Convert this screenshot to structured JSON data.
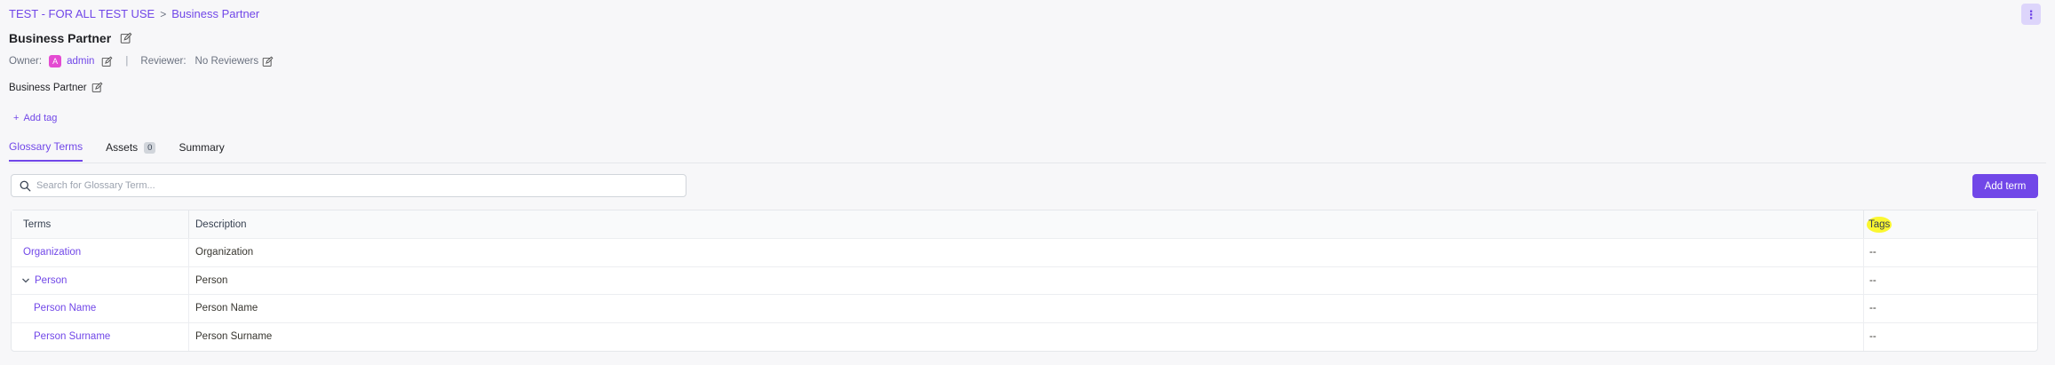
{
  "breadcrumb": {
    "parent": "TEST - FOR ALL TEST USE",
    "separator": ">",
    "current": "Business Partner"
  },
  "header": {
    "title": "Business Partner",
    "more_icon": "more-vertical-icon"
  },
  "owner": {
    "owner_label": "Owner:",
    "avatar_initial": "A",
    "owner_name": "admin",
    "divider": "|",
    "reviewer_label": "Reviewer:",
    "reviewer_value": "No Reviewers"
  },
  "description": {
    "text": "Business Partner"
  },
  "tags": {
    "add_label": "Add tag"
  },
  "tabs": [
    {
      "label": "Glossary Terms",
      "active": true
    },
    {
      "label": "Assets",
      "count": "0",
      "active": false
    },
    {
      "label": "Summary",
      "active": false
    }
  ],
  "search": {
    "placeholder": "Search for Glossary Term..."
  },
  "actions": {
    "add_term_label": "Add term"
  },
  "table": {
    "columns": [
      "Terms",
      "Description",
      "Tags"
    ],
    "rows": [
      {
        "term": "Organization",
        "description": "Organization",
        "tags": "--"
      },
      {
        "term": "Person",
        "description": "Person",
        "tags": "--",
        "expanded": true
      },
      {
        "term": "Person Name",
        "description": "Person Name",
        "tags": "--"
      },
      {
        "term": "Person Surname",
        "description": "Person Surname",
        "tags": "--"
      }
    ]
  },
  "colors": {
    "accent": "#7147e8",
    "highlight": "#fbf730",
    "avatar": "#e44bd2"
  }
}
